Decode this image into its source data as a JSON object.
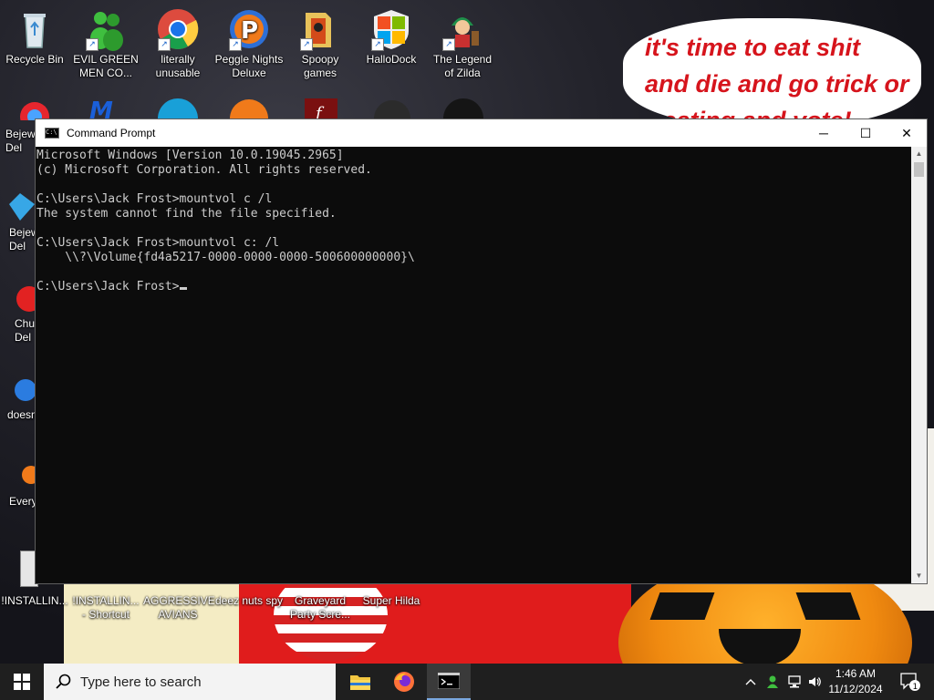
{
  "desktop": {
    "wallpaper_text": "it's time to eat shit and die and go trick or treating and vote!",
    "icons_top": [
      {
        "label": "Recycle Bin"
      },
      {
        "label": "EVIL GREEN MEN CO..."
      },
      {
        "label": "literally unusable"
      },
      {
        "label": "Peggle Nights Deluxe"
      },
      {
        "label": "Spoopy games"
      },
      {
        "label": "HalloDock"
      },
      {
        "label": "The Legend of Zilda"
      }
    ],
    "icons_left": [
      {
        "label": "Bejew Del"
      },
      {
        "label": "Bejew Del"
      },
      {
        "label": "Chu Del"
      },
      {
        "label": "doesn"
      },
      {
        "label": "Every"
      }
    ],
    "icons_bottom": [
      {
        "label": "!INSTALLIN..."
      },
      {
        "label": "!INSTALLIN... - Shortcut"
      },
      {
        "label": "AGGRESSIVE AVIANS"
      },
      {
        "label": "deez nuts spy"
      },
      {
        "label": "Graveyard Party Scre..."
      },
      {
        "label": "Super Hilda"
      }
    ]
  },
  "cmd": {
    "title": "Command Prompt",
    "lines": [
      "Microsoft Windows [Version 10.0.19045.2965]",
      "(c) Microsoft Corporation. All rights reserved.",
      "",
      "C:\\Users\\Jack Frost>mountvol c /l",
      "The system cannot find the file specified.",
      "",
      "C:\\Users\\Jack Frost>mountvol c: /l",
      "    \\\\?\\Volume{fd4a5217-0000-0000-0000-500600000000}\\",
      ""
    ],
    "prompt": "C:\\Users\\Jack Frost>",
    "minimize": "─",
    "maximize": "☐",
    "close": "✕"
  },
  "taskbar": {
    "search_placeholder": "Type here to search",
    "time": "1:46 AM",
    "date": "11/12/2024",
    "notification_count": "1"
  },
  "colors": {
    "console_bg": "#0c0c0c",
    "console_fg": "#cccccc",
    "taskbar_bg": "#1f1f1f"
  }
}
